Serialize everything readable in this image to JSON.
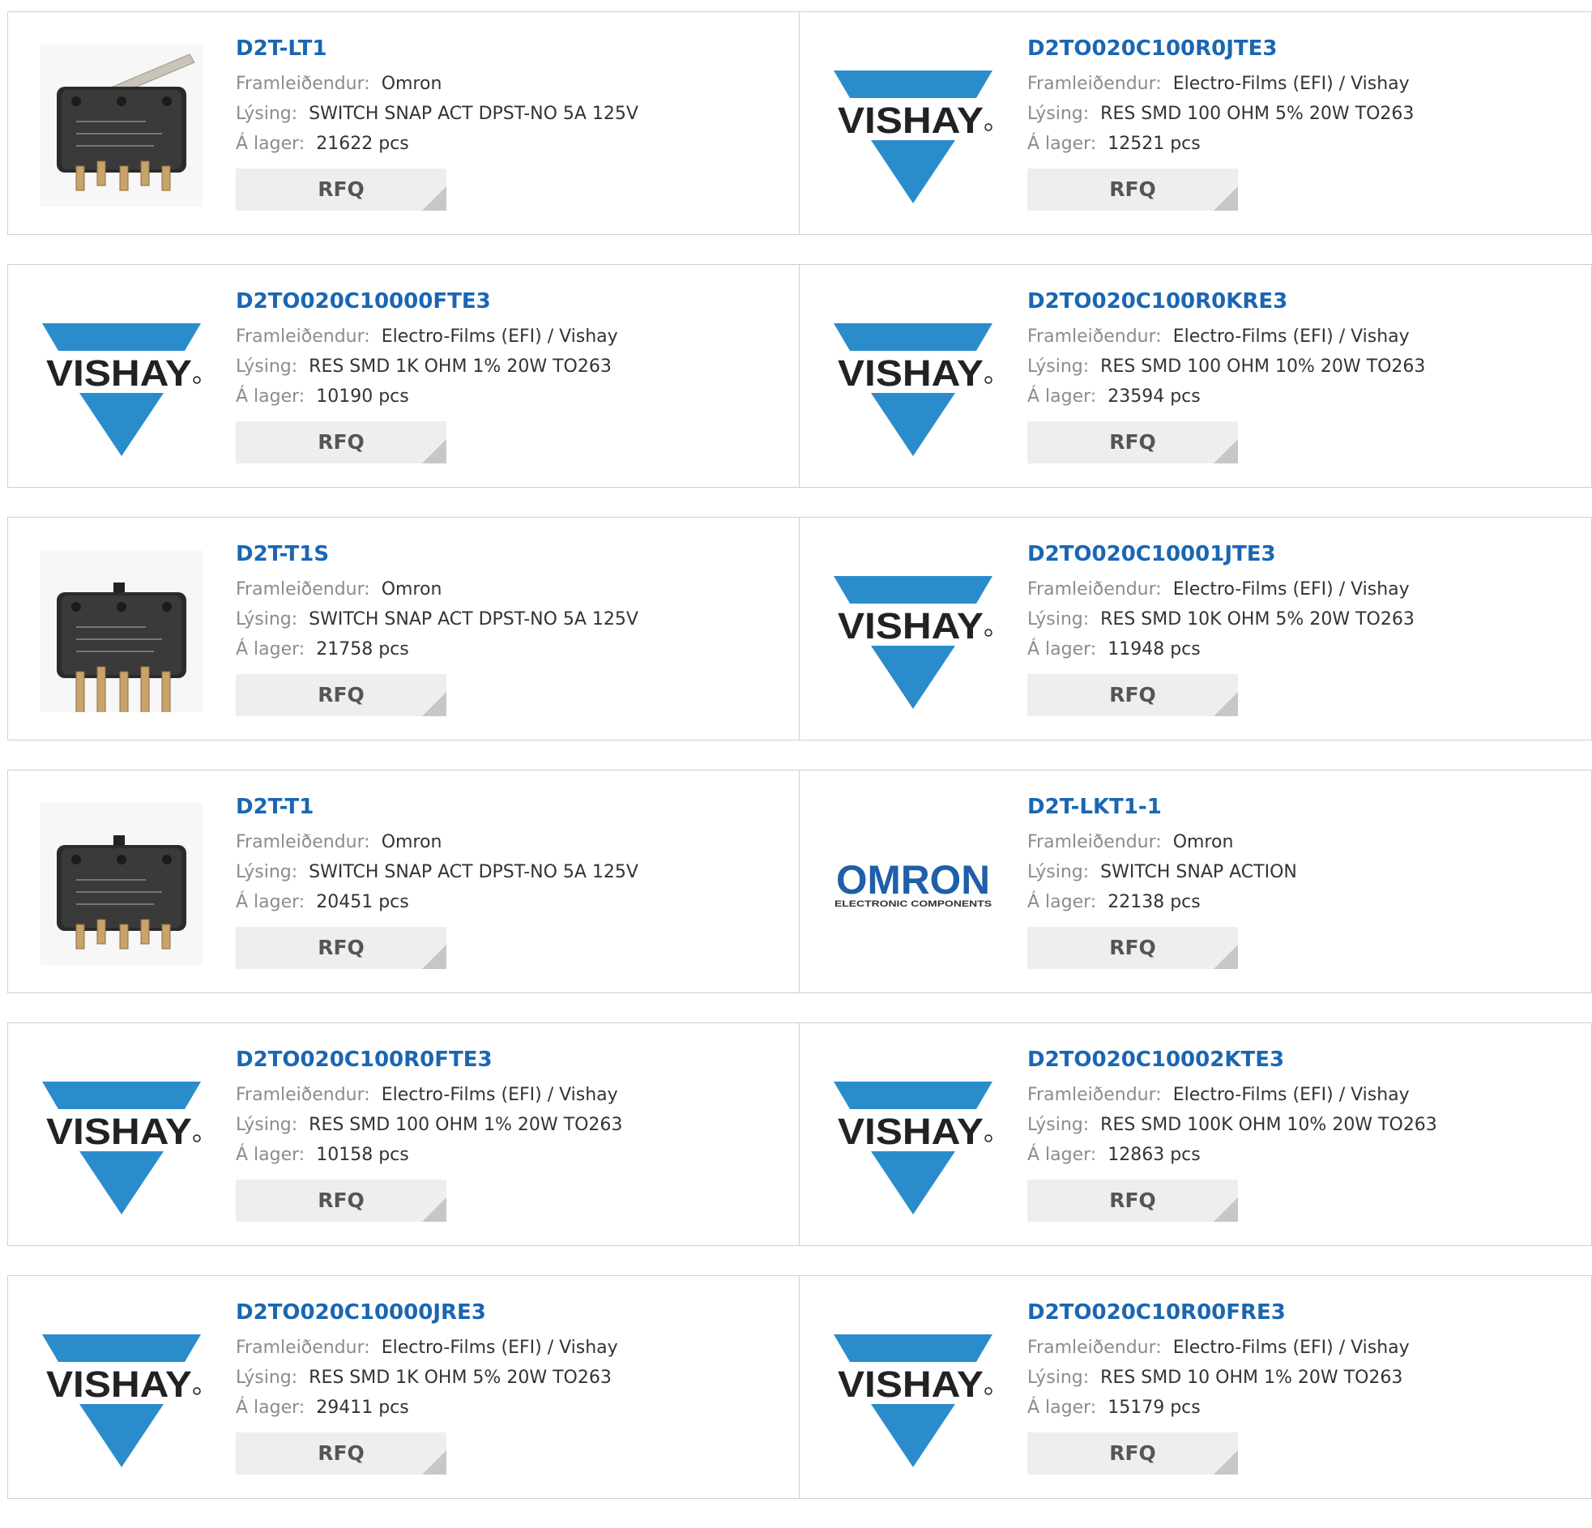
{
  "labels": {
    "manufacturer": "Framleiðendur:",
    "description": "Lýsing:",
    "stock": "Á lager:",
    "rfq": "RFQ"
  },
  "colors": {
    "part_link": "#1a66b3",
    "vishay_blue": "#2b8ccc",
    "omron_blue": "#1d5fa8",
    "border": "#cfcfcf",
    "rfq_bg": "#eeeeee"
  },
  "logo_text": {
    "vishay": "VISHAY",
    "omron": "OMRON",
    "omron_sub": "ELECTRONIC COMPONENTS"
  },
  "products": [
    {
      "part": "D2T-LT1",
      "manufacturer": "Omron",
      "description": "SWITCH SNAP ACT DPST-NO 5A 125V",
      "stock": "21622 pcs",
      "image": "switch-lever"
    },
    {
      "part": "D2TO020C100R0JTE3",
      "manufacturer": "Electro-Films (EFI) / Vishay",
      "description": "RES SMD 100 OHM 5% 20W TO263",
      "stock": "12521 pcs",
      "image": "vishay-logo"
    },
    {
      "part": "D2TO020C10000FTE3",
      "manufacturer": "Electro-Films (EFI) / Vishay",
      "description": "RES SMD 1K OHM 1% 20W TO263",
      "stock": "10190 pcs",
      "image": "vishay-logo"
    },
    {
      "part": "D2TO020C100R0KRE3",
      "manufacturer": "Electro-Films (EFI) / Vishay",
      "description": "RES SMD 100 OHM 10% 20W TO263",
      "stock": "23594 pcs",
      "image": "vishay-logo"
    },
    {
      "part": "D2T-T1S",
      "manufacturer": "Omron",
      "description": "SWITCH SNAP ACT DPST-NO 5A 125V",
      "stock": "21758 pcs",
      "image": "switch-long-pins"
    },
    {
      "part": "D2TO020C10001JTE3",
      "manufacturer": "Electro-Films (EFI) / Vishay",
      "description": "RES SMD 10K OHM 5% 20W TO263",
      "stock": "11948 pcs",
      "image": "vishay-logo"
    },
    {
      "part": "D2T-T1",
      "manufacturer": "Omron",
      "description": "SWITCH SNAP ACT DPST-NO 5A 125V",
      "stock": "20451 pcs",
      "image": "switch-plunger"
    },
    {
      "part": "D2T-LKT1-1",
      "manufacturer": "Omron",
      "description": "SWITCH SNAP ACTION",
      "stock": "22138 pcs",
      "image": "omron-logo"
    },
    {
      "part": "D2TO020C100R0FTE3",
      "manufacturer": "Electro-Films (EFI) / Vishay",
      "description": "RES SMD 100 OHM 1% 20W TO263",
      "stock": "10158 pcs",
      "image": "vishay-logo"
    },
    {
      "part": "D2TO020C10002KTE3",
      "manufacturer": "Electro-Films (EFI) / Vishay",
      "description": "RES SMD 100K OHM 10% 20W TO263",
      "stock": "12863 pcs",
      "image": "vishay-logo"
    },
    {
      "part": "D2TO020C10000JRE3",
      "manufacturer": "Electro-Films (EFI) / Vishay",
      "description": "RES SMD 1K OHM 5% 20W TO263",
      "stock": "29411 pcs",
      "image": "vishay-logo"
    },
    {
      "part": "D2TO020C10R00FRE3",
      "manufacturer": "Electro-Films (EFI) / Vishay",
      "description": "RES SMD 10 OHM 1% 20W TO263",
      "stock": "15179 pcs",
      "image": "vishay-logo"
    }
  ]
}
